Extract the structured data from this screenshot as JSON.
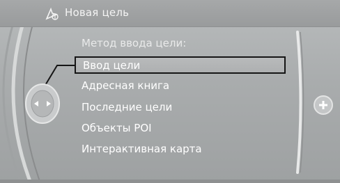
{
  "header": {
    "title": "Новая цель",
    "icon": "navigation-destination-icon"
  },
  "menu": {
    "heading": "Метод ввода цели:",
    "items": [
      {
        "label": "Ввод цели",
        "selected": true
      },
      {
        "label": "Адресная книга",
        "selected": false
      },
      {
        "label": "Последние цели",
        "selected": false
      },
      {
        "label": "Объекты POI",
        "selected": false
      },
      {
        "label": "Интерактивная карта",
        "selected": false
      }
    ]
  },
  "controller": {
    "left_knob_icon": "left-right-arrows-icon",
    "right_knob_icon": "plus-icon"
  },
  "colors": {
    "background": "#a9acad",
    "text": "#ffffff",
    "selection_border": "#151515"
  }
}
